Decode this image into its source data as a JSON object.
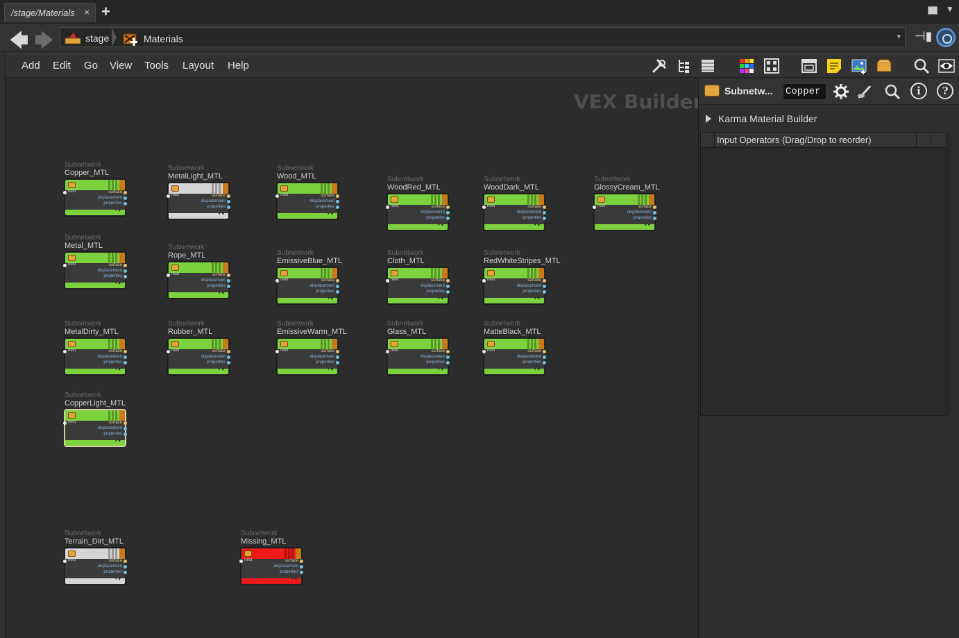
{
  "tab": {
    "label": "/stage/Materials",
    "close": "×",
    "add": "+"
  },
  "path": {
    "back": "🡄",
    "forward": "🡆",
    "crumbs": [
      "stage",
      "Materials"
    ],
    "dropdown": "▾"
  },
  "menu": {
    "items": [
      "Add",
      "Edit",
      "Go",
      "View",
      "Tools",
      "Layout",
      "Help"
    ]
  },
  "network": {
    "context_label": "VEX Builder",
    "nodes": [
      {
        "type": "Subnetwork",
        "name": "Copper_MTL",
        "color": "#7cd23c",
        "selected": false
      },
      {
        "type": "Subnetwork",
        "name": "MetalLight_MTL",
        "color": "#d6d6d6",
        "selected": false
      },
      {
        "type": "Subnetwork",
        "name": "Wood_MTL",
        "color": "#7cd23c",
        "selected": false
      },
      {
        "type": "Subnetwork",
        "name": "WoodRed_MTL",
        "color": "#7cd23c",
        "selected": false
      },
      {
        "type": "Subnetwork",
        "name": "WoodDark_MTL",
        "color": "#7cd23c",
        "selected": false
      },
      {
        "type": "Subnetwork",
        "name": "GlossyCream_MTL",
        "color": "#7cd23c",
        "selected": false
      },
      {
        "type": "Subnetwork",
        "name": "Metal_MTL",
        "color": "#7cd23c",
        "selected": false
      },
      {
        "type": "Subnetwork",
        "name": "Rope_MTL",
        "color": "#7cd23c",
        "selected": false
      },
      {
        "type": "Subnetwork",
        "name": "EmissiveBlue_MTL",
        "color": "#7cd23c",
        "selected": false
      },
      {
        "type": "Subnetwork",
        "name": "Cloth_MTL",
        "color": "#7cd23c",
        "selected": false
      },
      {
        "type": "Subnetwork",
        "name": "RedWhiteStripes_MTL",
        "color": "#7cd23c",
        "selected": false
      },
      {
        "type": "Subnetwork",
        "name": "MetalDirty_MTL",
        "color": "#7cd23c",
        "selected": false
      },
      {
        "type": "Subnetwork",
        "name": "Rubber_MTL",
        "color": "#7cd23c",
        "selected": false
      },
      {
        "type": "Subnetwork",
        "name": "EmissiveWarm_MTL",
        "color": "#7cd23c",
        "selected": false
      },
      {
        "type": "Subnetwork",
        "name": "Glass_MTL",
        "color": "#7cd23c",
        "selected": false
      },
      {
        "type": "Subnetwork",
        "name": "MatteBlack_MTL",
        "color": "#7cd23c",
        "selected": false
      },
      {
        "type": "Subnetwork",
        "name": "CopperLight_MTL",
        "color": "#7cd23c",
        "selected": true
      },
      {
        "type": "Subnetwork",
        "name": "Terrain_Dirt_MTL",
        "color": "#d6d6d6",
        "selected": false
      },
      {
        "type": "Subnetwork",
        "name": "Missing_MTL",
        "color": "#ee1a1a",
        "selected": false
      }
    ],
    "ports": {
      "input": "next",
      "outputs": [
        "surface",
        "displacement",
        "properties"
      ]
    }
  },
  "params": {
    "op_type": "Subnetw...",
    "op_name": "Copper",
    "folder": "Karma Material Builder",
    "inputs_header": "Input Operators (Drag/Drop to reorder)",
    "info_glyph": "i",
    "help_glyph": "?"
  }
}
